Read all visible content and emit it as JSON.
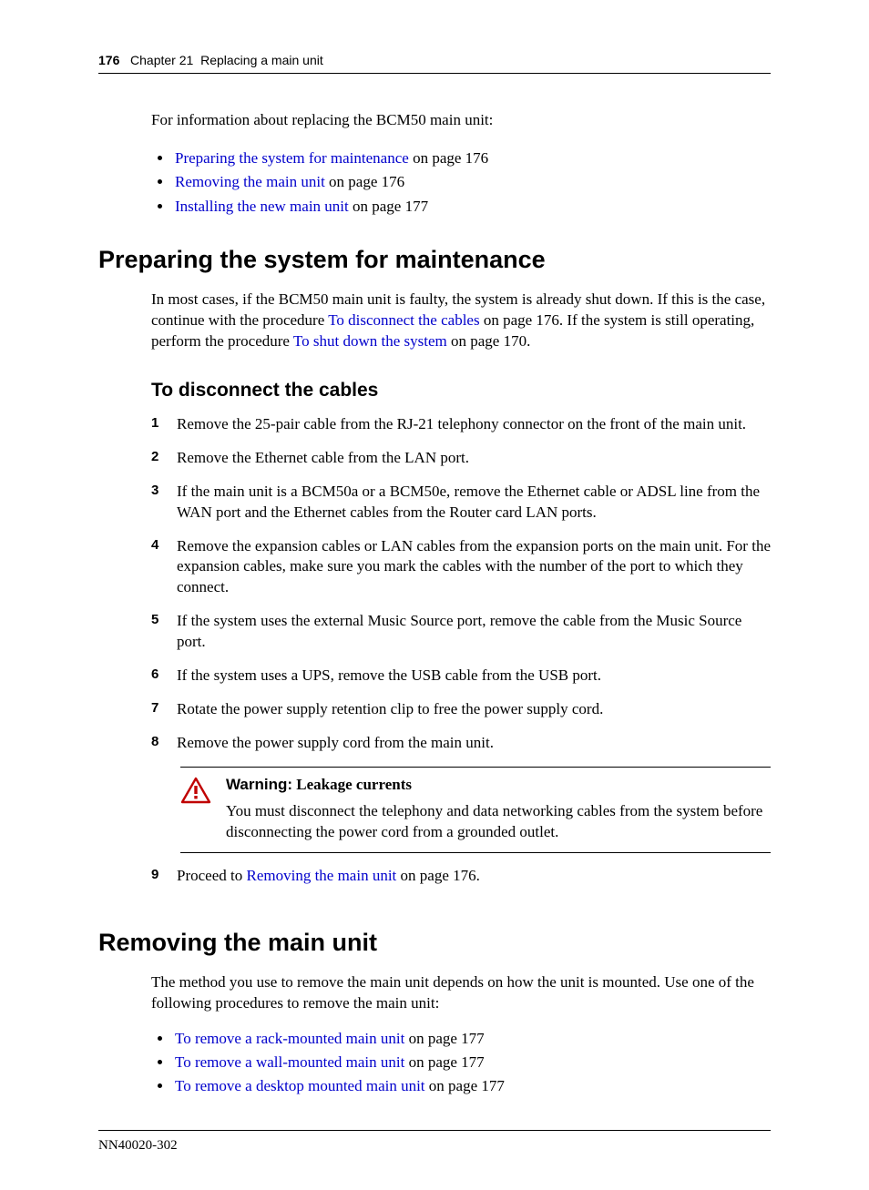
{
  "header": {
    "page_number": "176",
    "chapter_label": "Chapter 21",
    "chapter_title": "Replacing a main unit"
  },
  "intro_line": "For information about replacing the BCM50 main unit:",
  "toc": [
    {
      "link": "Preparing the system for maintenance",
      "suffix": " on page 176"
    },
    {
      "link": "Removing the main unit",
      "suffix": " on page 176"
    },
    {
      "link": "Installing the new main unit",
      "suffix": " on page 177"
    }
  ],
  "section1": {
    "heading": "Preparing the system for maintenance",
    "para_a": "In most cases, if the BCM50 main unit is faulty, the system is already shut down. If this is the case, continue with the procedure ",
    "link1": "To disconnect the cables",
    "para_b": " on page 176. If the system is still operating, perform the procedure ",
    "link2": "To shut down the system",
    "para_c": " on page 170.",
    "subheading": "To disconnect the cables",
    "steps": [
      "Remove the 25-pair cable from the RJ-21 telephony connector on the front of the main unit.",
      "Remove the Ethernet cable from the LAN port.",
      "If the main unit is a BCM50a or a BCM50e, remove the Ethernet cable or ADSL line from the WAN port and the Ethernet cables from the Router card LAN ports.",
      "Remove the expansion cables or LAN cables from the expansion ports on the main unit. For the expansion cables, make sure you mark the cables with the number of the port to which they connect.",
      "If the system uses the external Music Source port, remove the cable from the Music Source port.",
      "If the system uses a UPS, remove the USB cable from the USB port.",
      "Rotate the power supply retention clip to free the power supply cord.",
      "Remove the power supply cord from the main unit."
    ],
    "warning": {
      "label": "Warning:",
      "subject": "Leakage currents",
      "body": "You must disconnect the telephony and data networking cables from the system before disconnecting the power cord from a grounded outlet."
    },
    "step9_a": "Proceed to ",
    "step9_link": "Removing the main unit",
    "step9_b": " on page 176."
  },
  "section2": {
    "heading": "Removing the main unit",
    "para": "The method you use to remove the main unit depends on how the unit is mounted. Use one of the following procedures to remove the main unit:",
    "toc": [
      {
        "link": "To remove a rack-mounted main unit",
        "suffix": " on page 177"
      },
      {
        "link": "To remove a wall-mounted main unit",
        "suffix": " on page 177"
      },
      {
        "link": "To remove a desktop mounted main unit",
        "suffix": " on page 177"
      }
    ]
  },
  "footer": {
    "doc_id": "NN40020-302"
  }
}
